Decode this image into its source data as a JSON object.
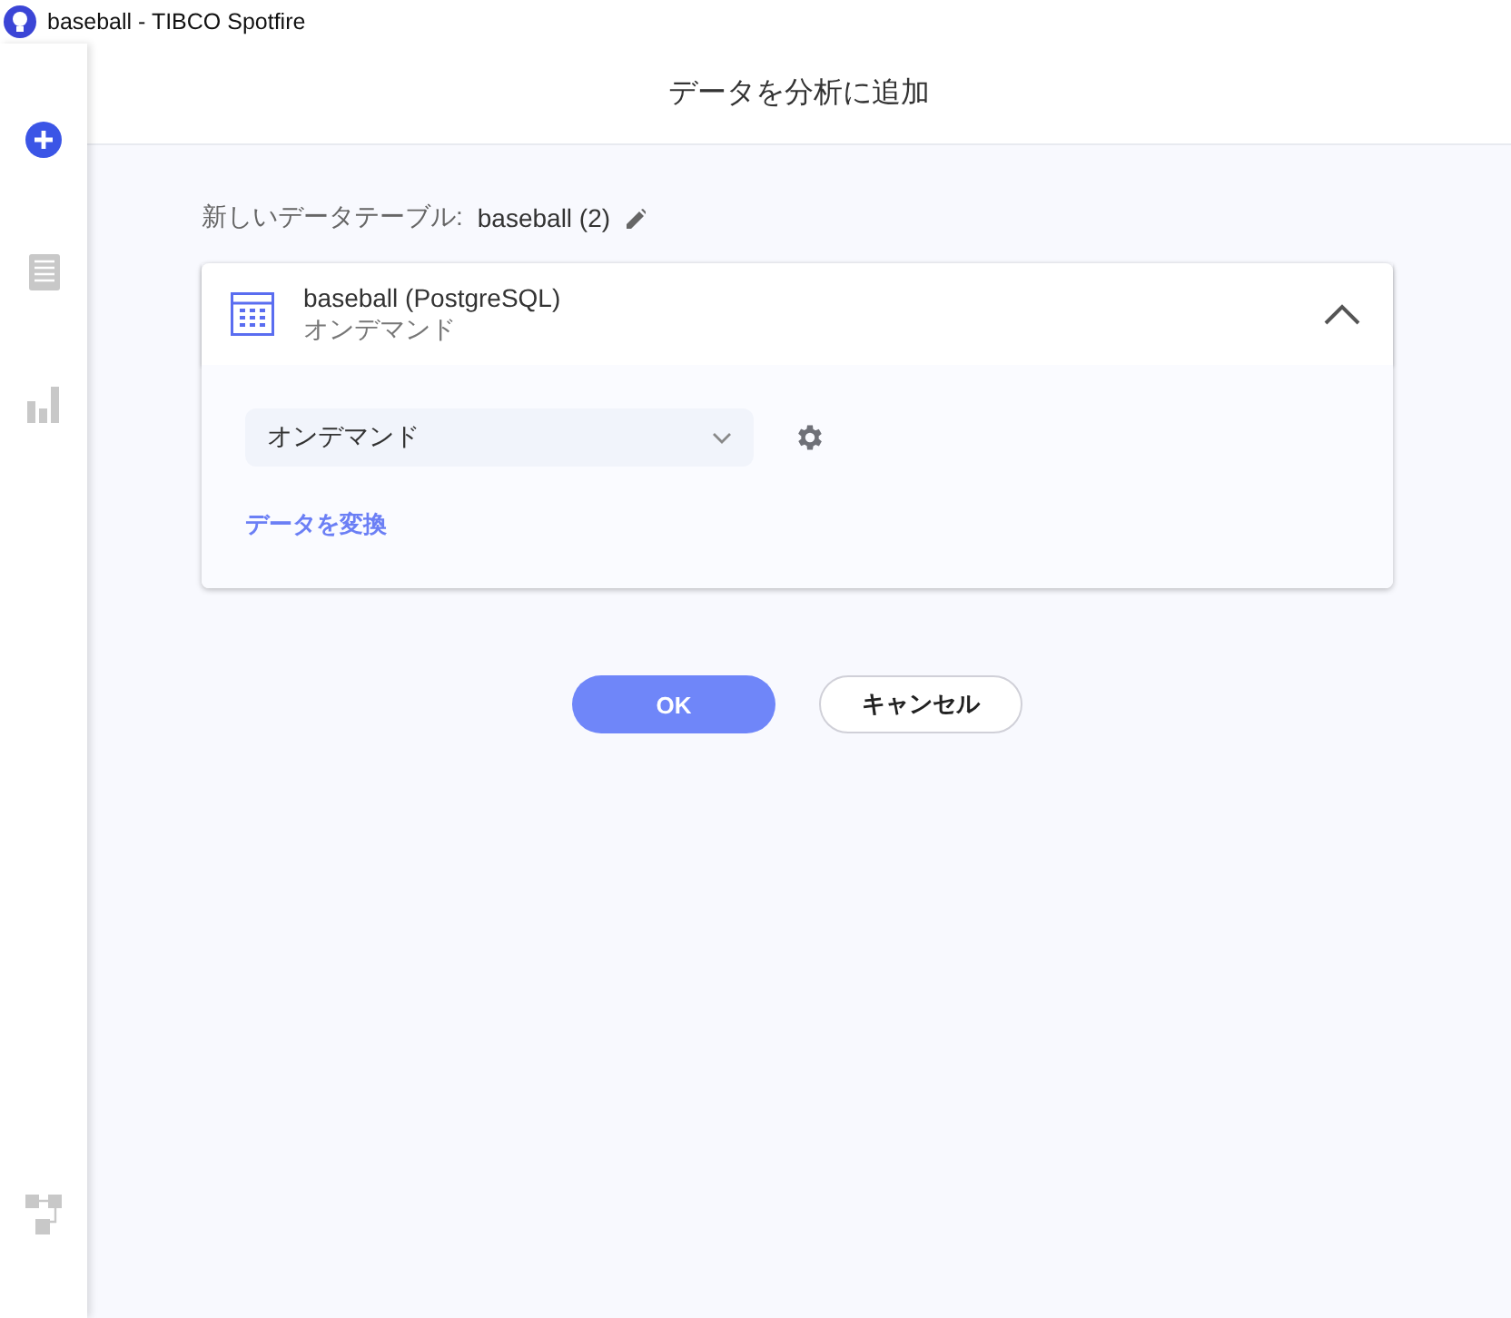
{
  "window": {
    "title": "baseball - TIBCO Spotfire"
  },
  "sidebar": {
    "items": [
      {
        "kind": "add",
        "selected": true
      },
      {
        "kind": "table",
        "selected": false
      },
      {
        "kind": "chart",
        "selected": false
      }
    ],
    "bottom_item": {
      "kind": "flow"
    }
  },
  "header": {
    "title": "データを分析に追加"
  },
  "new_table": {
    "label": "新しいデータテーブル:",
    "name": "baseball (2)"
  },
  "source_card": {
    "title": "baseball (PostgreSQL)",
    "subtitle": "オンデマンド",
    "expanded": true,
    "load_method": {
      "value": "オンデマンド"
    },
    "transform_link": "データを変換"
  },
  "buttons": [
    {
      "label": "OK",
      "kind": "primary"
    },
    {
      "label": "キャンセル",
      "kind": "secondary"
    }
  ]
}
